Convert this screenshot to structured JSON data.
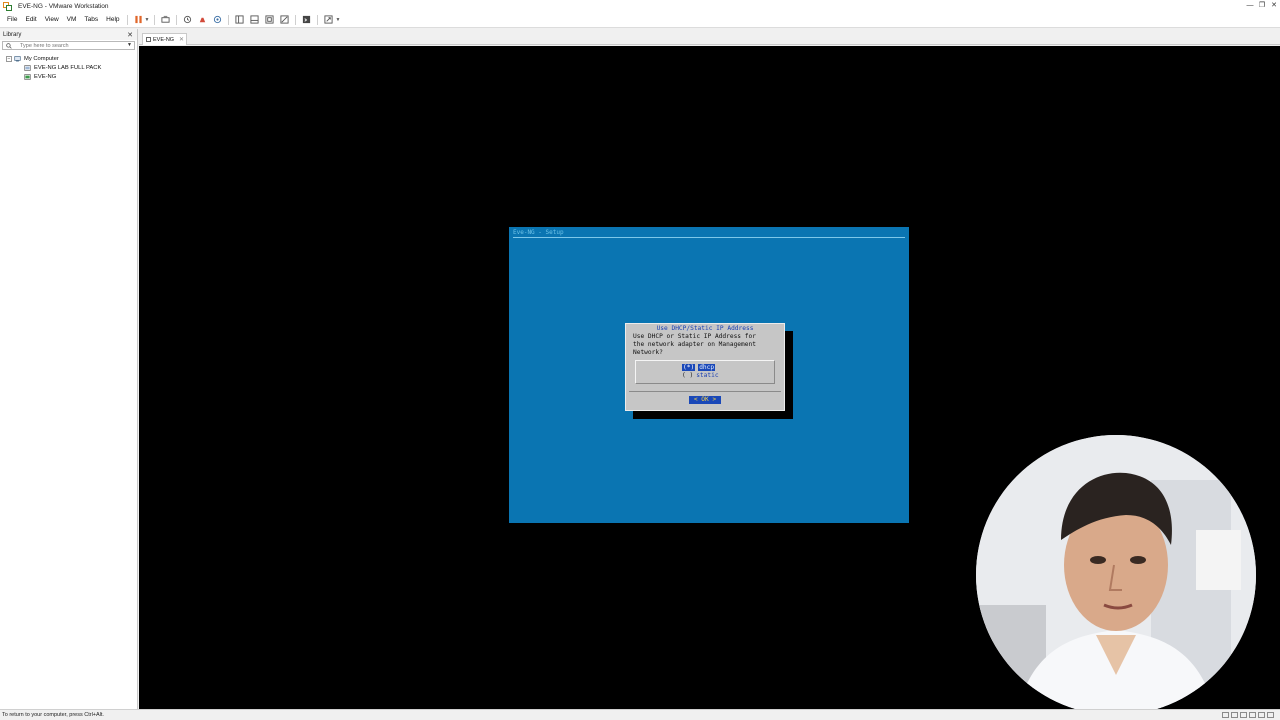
{
  "window": {
    "title": "EVE-NG - VMware Workstation",
    "controls": [
      "—",
      "❐",
      "✕"
    ]
  },
  "menu": {
    "items": [
      "File",
      "Edit",
      "View",
      "VM",
      "Tabs",
      "Help"
    ]
  },
  "toolbar": {
    "icons": [
      "pause-icon",
      "send-ctrl-alt-del-icon",
      "snapshot-icon",
      "revert-snapshot-icon",
      "snapshot-manager-icon",
      "show-library-icon",
      "thumbnail-bar-icon",
      "full-screen-icon",
      "unity-icon",
      "console-view-icon",
      "stretch-guest-icon"
    ]
  },
  "library": {
    "label": "Library",
    "close": "✕",
    "search_placeholder": "Type here to search",
    "tree": {
      "root": "My Computer",
      "expander": "−",
      "children": [
        "EVE-NG LAB FULL PACK",
        "EVE-NG"
      ]
    }
  },
  "tabs": {
    "active": "EVE-NG",
    "close": "✕"
  },
  "console": {
    "backtitle": "Eve-NG - Setup",
    "dialog": {
      "title": "Use DHCP/Static IP Address",
      "prompt_line1": "Use DHCP or Static IP Address for",
      "prompt_line2": "the network adapter on Management",
      "prompt_line3": "Network?",
      "option1_mark": "(*)",
      "option1_label": "dhcp",
      "option2_mark": "( )",
      "option2_label": "static",
      "ok_button": "<  OK  >"
    }
  },
  "status": {
    "text": "To return to your computer, press Ctrl+Alt."
  },
  "colors": {
    "console_bg": "#0a75b2",
    "dialog_bg": "#c6c6c6",
    "selection": "#1a48b8",
    "ok_text": "#f2d04a"
  }
}
